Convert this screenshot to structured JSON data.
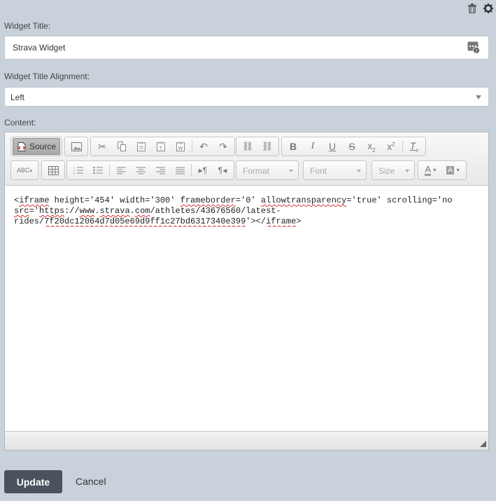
{
  "header": {
    "icons": [
      "trash-icon",
      "gear-icon"
    ]
  },
  "form": {
    "title_label": "Widget Title:",
    "title_value": "Strava Widget",
    "alignment_label": "Widget Title Alignment:",
    "alignment_value": "Left",
    "content_label": "Content:"
  },
  "toolbar": {
    "source_label": "Source",
    "format_placeholder": "Format",
    "font_placeholder": "Font",
    "size_placeholder": "Size"
  },
  "editor": {
    "line1": {
      "a": "<",
      "b": "iframe",
      "c": " height='454' width='300' ",
      "d": "frameborder",
      "e": "='0' ",
      "f": "allowtransparency",
      "g": "='true' scrolling='no"
    },
    "line2": {
      "a": "src",
      "b": "='",
      "c": "https",
      "d": "://",
      "e": "www",
      "f": ".",
      "g": "strava",
      "h": ".",
      "i": "com",
      "j": "/athletes/43676560/latest-"
    },
    "line3": {
      "a": "rides/",
      "b": "7f20dc12064d7d05e69d9ff1c27bd6317340e399",
      "c": "'></",
      "d": "iframe",
      "e": ">"
    }
  },
  "actions": {
    "update_label": "Update",
    "cancel_label": "Cancel"
  }
}
